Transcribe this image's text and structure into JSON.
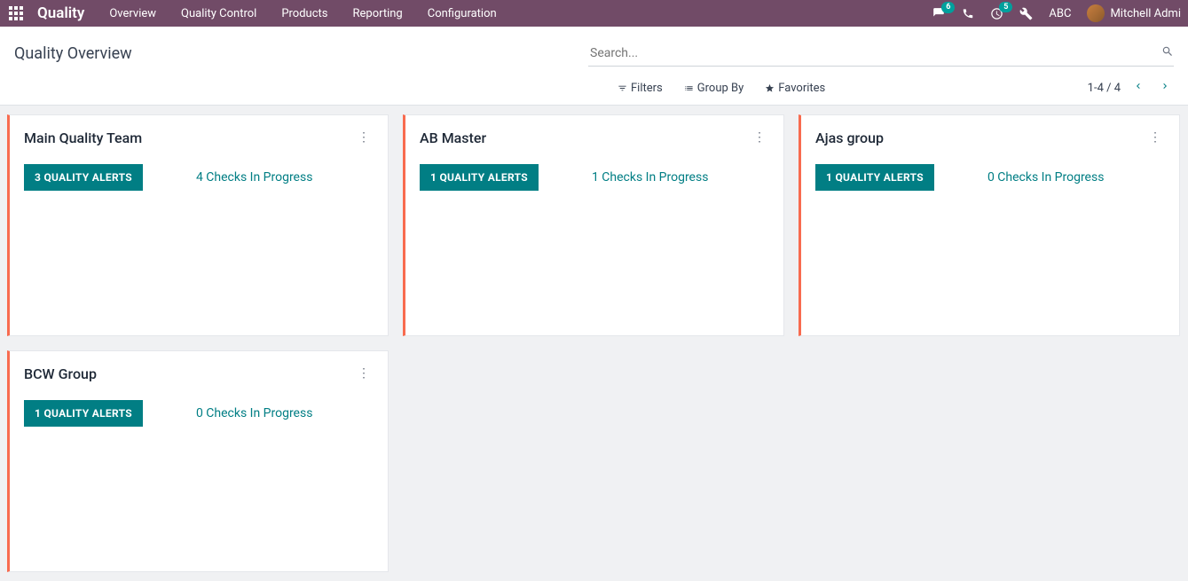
{
  "header": {
    "brand": "Quality",
    "menu": [
      "Overview",
      "Quality Control",
      "Products",
      "Reporting",
      "Configuration"
    ],
    "chat_badge": "6",
    "activity_badge": "5",
    "company": "ABC",
    "user_name": "Mitchell Admi"
  },
  "control": {
    "breadcrumb": "Quality Overview",
    "search_placeholder": "Search...",
    "filters_label": "Filters",
    "groupby_label": "Group By",
    "favorites_label": "Favorites",
    "pager": "1-4 / 4"
  },
  "cards": {
    "c0": {
      "title": "Main Quality Team",
      "alerts": "3 QUALITY ALERTS",
      "checks": "4 Checks In Progress"
    },
    "c1": {
      "title": "AB Master",
      "alerts": "1 QUALITY ALERTS",
      "checks": "1 Checks In Progress"
    },
    "c2": {
      "title": "Ajas group",
      "alerts": "1 QUALITY ALERTS",
      "checks": "0 Checks In Progress"
    },
    "c3": {
      "title": "BCW Group",
      "alerts": "1 QUALITY ALERTS",
      "checks": "0 Checks In Progress"
    }
  }
}
